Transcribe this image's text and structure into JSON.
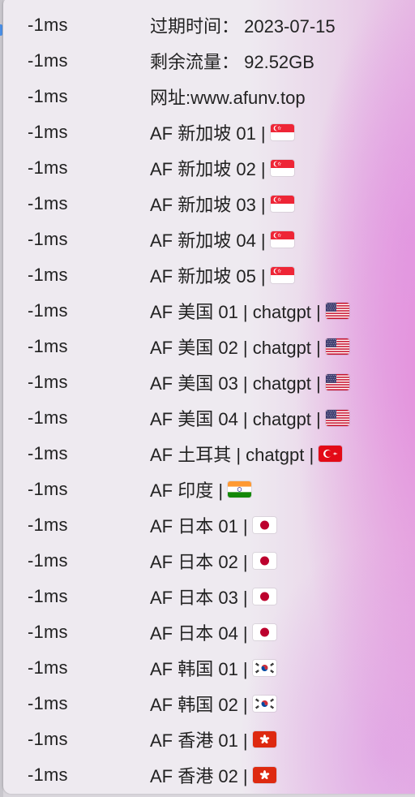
{
  "menu": {
    "rows": [
      {
        "latency": "-1ms",
        "label": "过期时间：  2023-07-15",
        "flag": ""
      },
      {
        "latency": "-1ms",
        "label": "剩余流量：  92.52GB",
        "flag": ""
      },
      {
        "latency": "-1ms",
        "label": "网址:www.afunv.top",
        "flag": ""
      },
      {
        "latency": "-1ms",
        "label": "AF 新加坡 01 |",
        "flag": "sg"
      },
      {
        "latency": "-1ms",
        "label": "AF 新加坡 02 |",
        "flag": "sg"
      },
      {
        "latency": "-1ms",
        "label": "AF 新加坡 03 |",
        "flag": "sg"
      },
      {
        "latency": "-1ms",
        "label": "AF 新加坡 04 |",
        "flag": "sg"
      },
      {
        "latency": "-1ms",
        "label": "AF 新加坡 05 |",
        "flag": "sg"
      },
      {
        "latency": "-1ms",
        "label": "AF 美国 01 | chatgpt |",
        "flag": "us"
      },
      {
        "latency": "-1ms",
        "label": "AF 美国 02 | chatgpt |",
        "flag": "us"
      },
      {
        "latency": "-1ms",
        "label": "AF 美国 03 | chatgpt |",
        "flag": "us"
      },
      {
        "latency": "-1ms",
        "label": "AF 美国 04 | chatgpt |",
        "flag": "us"
      },
      {
        "latency": "-1ms",
        "label": "AF 土耳其 | chatgpt |",
        "flag": "tr"
      },
      {
        "latency": "-1ms",
        "label": "AF 印度 |",
        "flag": "in"
      },
      {
        "latency": "-1ms",
        "label": "AF 日本 01 |",
        "flag": "jp"
      },
      {
        "latency": "-1ms",
        "label": "AF 日本 02 |",
        "flag": "jp"
      },
      {
        "latency": "-1ms",
        "label": "AF 日本 03 |",
        "flag": "jp"
      },
      {
        "latency": "-1ms",
        "label": "AF 日本 04 |",
        "flag": "jp"
      },
      {
        "latency": "-1ms",
        "label": "AF 韩国 01 |",
        "flag": "kr"
      },
      {
        "latency": "-1ms",
        "label": "AF 韩国 02 |",
        "flag": "kr"
      },
      {
        "latency": "-1ms",
        "label": "AF 香港 01 |",
        "flag": "hk"
      },
      {
        "latency": "-1ms",
        "label": "AF 香港 02 |",
        "flag": "hk"
      }
    ]
  },
  "colors": {
    "text": "#222222",
    "accent": "#4a8fe6"
  }
}
